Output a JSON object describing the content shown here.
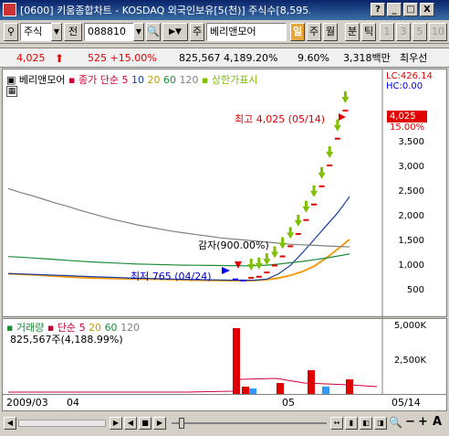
{
  "window": {
    "title": "[0600] 키움종합차트 - KOSDAQ 외국인보유[5(천)] 주식수[8,595.2",
    "buttons": [
      "?",
      "_",
      "□",
      "X"
    ]
  },
  "toolbar": {
    "market_type": "주식",
    "period_label": "전",
    "stock_code": "088810",
    "jong_label": "주",
    "stock_name": "베리앤모어",
    "tabs": [
      "일",
      "주",
      "월",
      "분",
      "틱"
    ],
    "tick_options": [
      "1",
      "3",
      "5",
      "10"
    ]
  },
  "pricebar": {
    "price": "4,025",
    "change": "525 +15.00%",
    "volume": "825,567 4,189.20%",
    "ratio": "9.60%",
    "amount": "3,318백만",
    "best": "최우선"
  },
  "chart": {
    "legend_name": "베리앤모어",
    "legend_ma_title": "종가 단순",
    "ma_periods": [
      "5",
      "10",
      "20",
      "60",
      "120"
    ],
    "limit_label": "상한가표시",
    "lc_label": "LC:426.14",
    "hc_label": "HC:0.00",
    "current_price_tag": "4,025",
    "current_pct_tag": "15.00%",
    "y_ticks": [
      "3,500",
      "3,000",
      "2,500",
      "2,000",
      "1,500",
      "1,000",
      "500"
    ],
    "high_annotation": "최고 4,025 (05/14)",
    "low_annotation": "최저 765 (04/24)",
    "capital_reduction": "감자(900.00%)",
    "colors": {
      "ma5": "#f39c12",
      "ma10": "#1a3fa0",
      "ma20": "#c0a000",
      "ma60": "#1e8c3a",
      "ma120": "#808080",
      "up": "#e00000",
      "down": "#0000ff",
      "limit_arrow": "#7fbf00"
    }
  },
  "volume": {
    "legend_title": "거래량",
    "ma_title": "단순",
    "ma_periods": [
      "5",
      "20",
      "60",
      "120"
    ],
    "info": "825,567주(4,188.99%)",
    "y_ticks": [
      "5,000K",
      "2,500K"
    ]
  },
  "dateaxis": {
    "labels": [
      "2009/03",
      "04",
      "05",
      "05/14"
    ]
  },
  "chart_data": {
    "type": "line",
    "title": "",
    "xlabel": "",
    "ylabel": "",
    "ylim": [
      250,
      4400
    ],
    "series": [
      {
        "name": "5",
        "values": [
          960,
          950,
          940,
          930,
          915,
          900,
          890,
          880,
          875,
          870,
          865,
          860,
          858,
          856,
          850,
          845,
          840,
          835,
          832,
          830,
          830,
          835,
          850,
          880,
          930,
          1000,
          1100,
          1250,
          1420,
          1600
        ]
      },
      {
        "name": "10",
        "values": [
          960,
          955,
          948,
          940,
          932,
          925,
          915,
          905,
          898,
          890,
          882,
          875,
          870,
          865,
          860,
          855,
          850,
          846,
          843,
          840,
          838,
          840,
          860,
          960,
          1120,
          1350,
          1600,
          1850,
          2100,
          2400
        ]
      },
      {
        "name": "120",
        "values": [
          2550,
          2480,
          2420,
          2350,
          2280,
          2220,
          2150,
          2090,
          2030,
          1970,
          1920,
          1870,
          1830,
          1790,
          1750,
          1720,
          1690,
          1660,
          1630,
          1610,
          1590,
          1570,
          1550,
          1530,
          1510,
          1500,
          1490,
          1480,
          1470,
          1460
        ]
      },
      {
        "name": "60",
        "values": [
          1280,
          1270,
          1255,
          1240,
          1225,
          1210,
          1195,
          1180,
          1170,
          1160,
          1150,
          1140,
          1135,
          1130,
          1125,
          1120,
          1118,
          1115,
          1112,
          1110,
          1108,
          1110,
          1120,
          1140,
          1165,
          1190,
          1220,
          1250,
          1290,
          1330
        ]
      }
    ],
    "candles_close": [
      870,
      850,
      900,
      920,
      1000,
      1130,
      1300,
      1490,
      1720,
      1980,
      2270,
      2610,
      3000,
      3500,
      4025
    ]
  }
}
